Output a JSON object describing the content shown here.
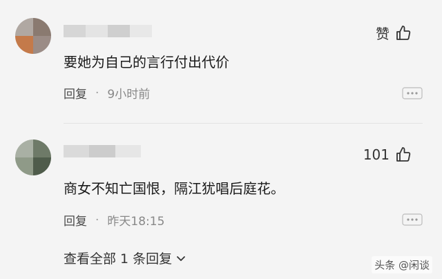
{
  "comments": [
    {
      "like_label": "赞",
      "text": "要她为自己的言行付出代价",
      "reply_label": "回复",
      "separator": "·",
      "time": "9小时前"
    },
    {
      "like_count": "101",
      "text": "商女不知亡国恨，隔江犹唱后庭花。",
      "reply_label": "回复",
      "separator": "·",
      "time": "昨天18:15"
    }
  ],
  "view_replies": {
    "label": "查看全部 1 条回复"
  },
  "watermark": {
    "text": "头条 @闲谈"
  },
  "colors": {
    "background": "#f4f4f4",
    "text": "#1a1a1a",
    "meta": "#666666"
  },
  "icons": {
    "like": "thumbs-up-icon",
    "more": "more-horizontal-icon",
    "expand": "chevron-down-icon"
  }
}
